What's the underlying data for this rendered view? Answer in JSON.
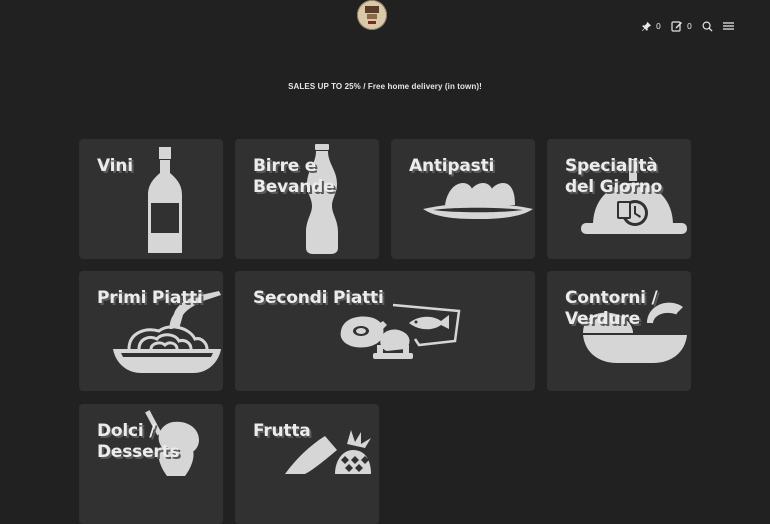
{
  "header": {
    "logo_icon": "restaurant-logo",
    "pin_count": "0",
    "edit_count": "0",
    "icons": [
      "pin-icon",
      "edit-icon",
      "search-icon",
      "menu-icon"
    ]
  },
  "promo": {
    "text": "SALES UP TO 25% / Free home delivery (in town)!"
  },
  "categories": [
    {
      "label": "Vini",
      "icon": "wine-bottle-icon"
    },
    {
      "label": "Birre e\nBevande",
      "icon": "soda-bottle-icon"
    },
    {
      "label": "Antipasti",
      "icon": "appetizer-plate-icon"
    },
    {
      "label": "Specialità\ndel Giorno",
      "icon": "cloche-clock-icon"
    },
    {
      "label": "Primi Piatti",
      "icon": "pasta-bowl-icon"
    },
    {
      "label": "Secondi Piatti",
      "icon": "meat-fish-icon"
    },
    {
      "label": "Contorni /\nVerdure",
      "icon": "salad-bowl-icon"
    },
    {
      "label": "Dolci /\nDesserts",
      "icon": "ice-cream-icon"
    },
    {
      "label": "Frutta",
      "icon": "fruit-icon"
    }
  ],
  "colors": {
    "background": "#212121",
    "tile": "#313131",
    "text": "#ececec",
    "icon": "#d6d6d6"
  }
}
